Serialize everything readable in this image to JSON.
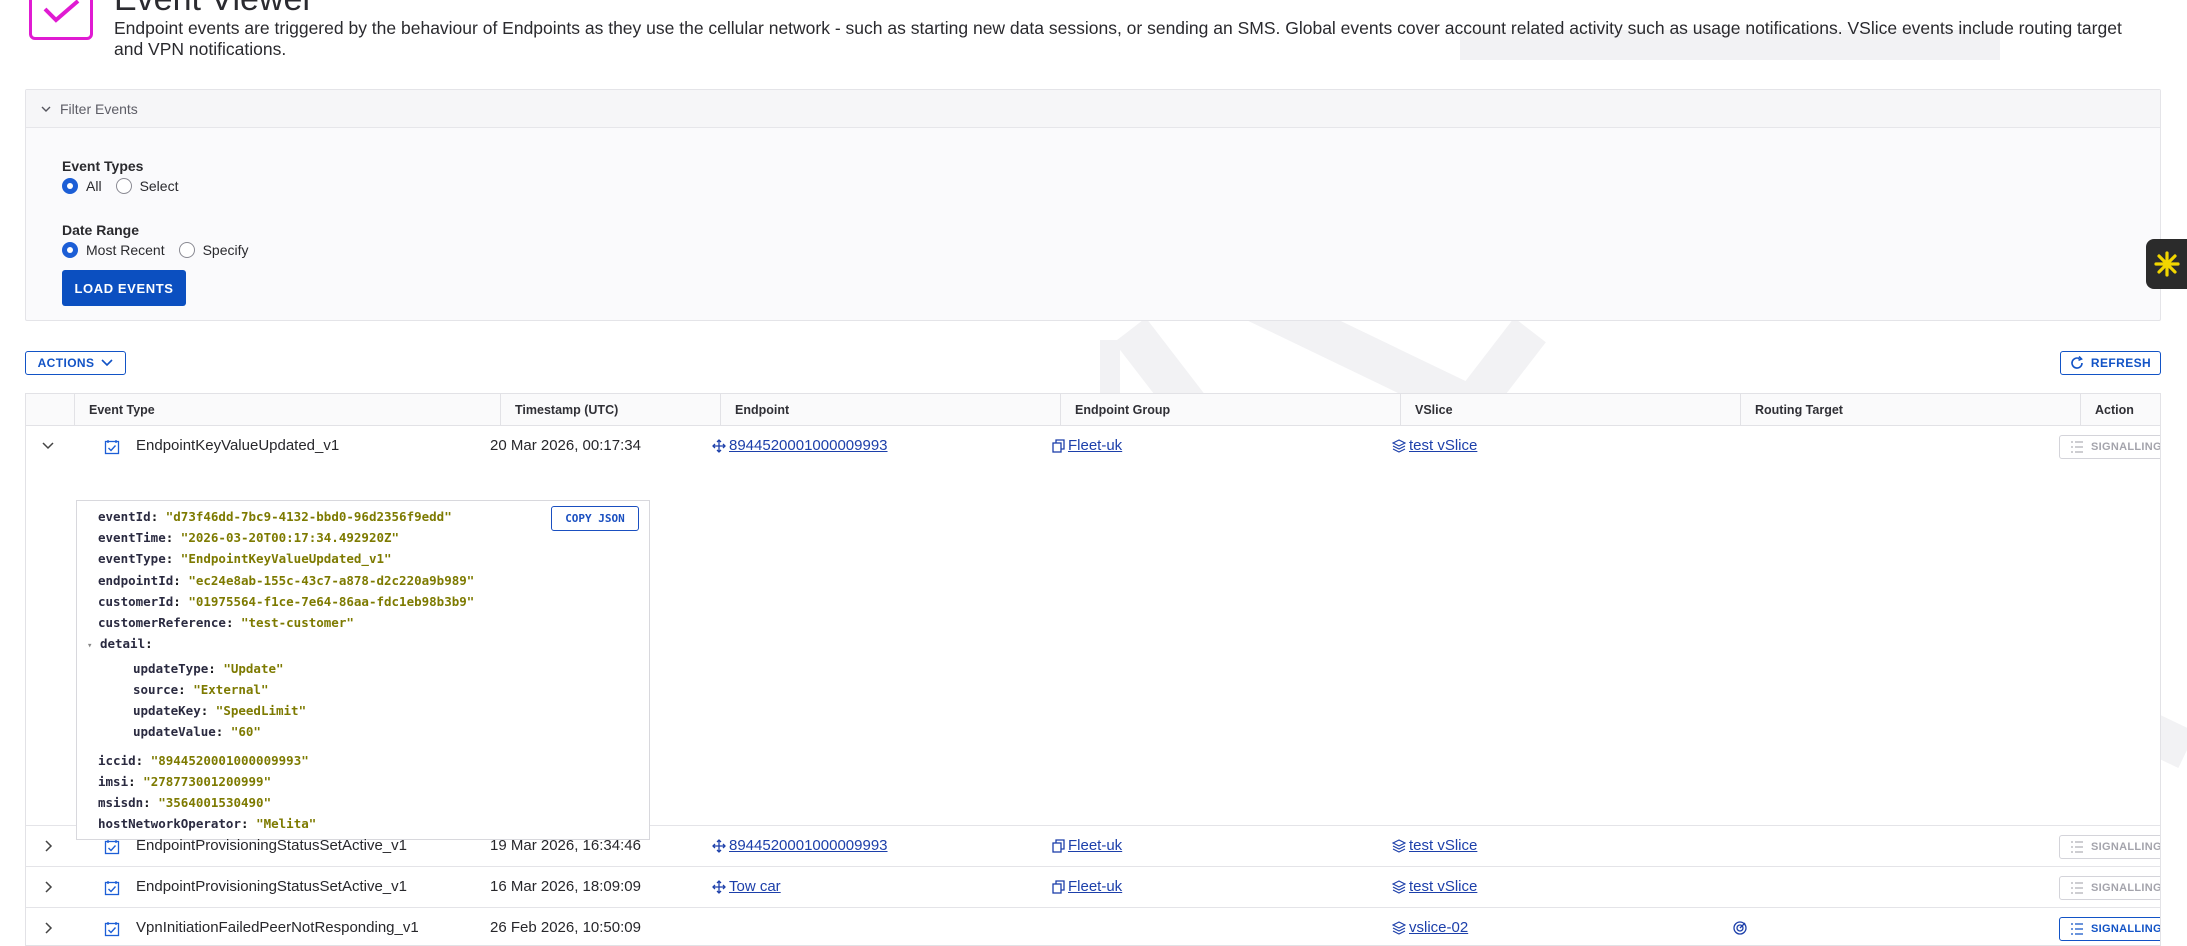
{
  "header": {
    "title": "Event Viewer",
    "description": "Endpoint events are triggered by the behaviour of Endpoints as they use the cellular network - such as starting new data sessions, or sending an SMS. Global events cover account related activity such as usage notifications. VSlice events include routing target and VPN notifications."
  },
  "filter": {
    "header_label": "Filter Events",
    "event_types": {
      "label": "Event Types",
      "options": [
        "All",
        "Select"
      ],
      "selected": "All"
    },
    "date_range": {
      "label": "Date Range",
      "options": [
        "Most Recent",
        "Specify"
      ],
      "selected": "Most Recent"
    },
    "load_button": "LOAD EVENTS"
  },
  "toolbar": {
    "actions_label": "ACTIONS",
    "refresh_label": "REFRESH"
  },
  "table": {
    "columns": [
      "Event Type",
      "Timestamp (UTC)",
      "Endpoint",
      "Endpoint Group",
      "VSlice",
      "Routing Target",
      "Action"
    ],
    "rows": [
      {
        "event_type": "EndpointKeyValueUpdated_v1",
        "timestamp": "20 Mar 2026, 00:17:34",
        "endpoint": "8944520001000009993",
        "endpoint_group": "Fleet-uk",
        "vslice": "test vSlice",
        "routing_target": "",
        "action": "SIGNALLING",
        "expanded": true
      },
      {
        "event_type": "EndpointProvisioningStatusSetActive_v1",
        "timestamp": "19 Mar 2026, 16:34:46",
        "endpoint": "8944520001000009993",
        "endpoint_group": "Fleet-uk",
        "vslice": "test vSlice",
        "routing_target": "",
        "action": "SIGNALLING",
        "expanded": false
      },
      {
        "event_type": "EndpointProvisioningStatusSetActive_v1",
        "timestamp": "16 Mar 2026, 18:09:09",
        "endpoint": "Tow car",
        "endpoint_group": "Fleet-uk",
        "vslice": "test vSlice",
        "routing_target": "",
        "action": "SIGNALLING",
        "expanded": false
      },
      {
        "event_type": "VpnInitiationFailedPeerNotResponding_v1",
        "timestamp": "26 Feb 2026, 10:50:09",
        "endpoint": "",
        "endpoint_group": "",
        "vslice": "vslice-02",
        "routing_target": "",
        "action": "SIGNALLING",
        "expanded": false
      }
    ]
  },
  "json_detail": {
    "copy_label": "COPY JSON",
    "top": [
      {
        "key": "eventId",
        "value": "\"d73f46dd-7bc9-4132-bbd0-96d2356f9edd\""
      },
      {
        "key": "eventTime",
        "value": "\"2026-03-20T00:17:34.492920Z\""
      },
      {
        "key": "eventType",
        "value": "\"EndpointKeyValueUpdated_v1\""
      },
      {
        "key": "endpointId",
        "value": "\"ec24e8ab-155c-43c7-a878-d2c220a9b989\""
      },
      {
        "key": "customerId",
        "value": "\"01975564-f1ce-7e64-86aa-fdc1eb98b3b9\""
      },
      {
        "key": "customerReference",
        "value": "\"test-customer\""
      }
    ],
    "detail_key": "detail",
    "detail": [
      {
        "key": "updateType",
        "value": "\"Update\""
      },
      {
        "key": "source",
        "value": "\"External\""
      },
      {
        "key": "updateKey",
        "value": "\"SpeedLimit\""
      },
      {
        "key": "updateValue",
        "value": "\"60\""
      }
    ],
    "bottom": [
      {
        "key": "iccid",
        "value": "\"8944520001000009993\""
      },
      {
        "key": "imsi",
        "value": "\"278773001200999\""
      },
      {
        "key": "msisdn",
        "value": "\"3564001530490\""
      },
      {
        "key": "hostNetworkOperator",
        "value": "\"Melita\""
      }
    ]
  },
  "colors": {
    "accent": "#0b4fc0",
    "brand_icon": "#e01bd2",
    "json_value": "#7d7a00"
  }
}
